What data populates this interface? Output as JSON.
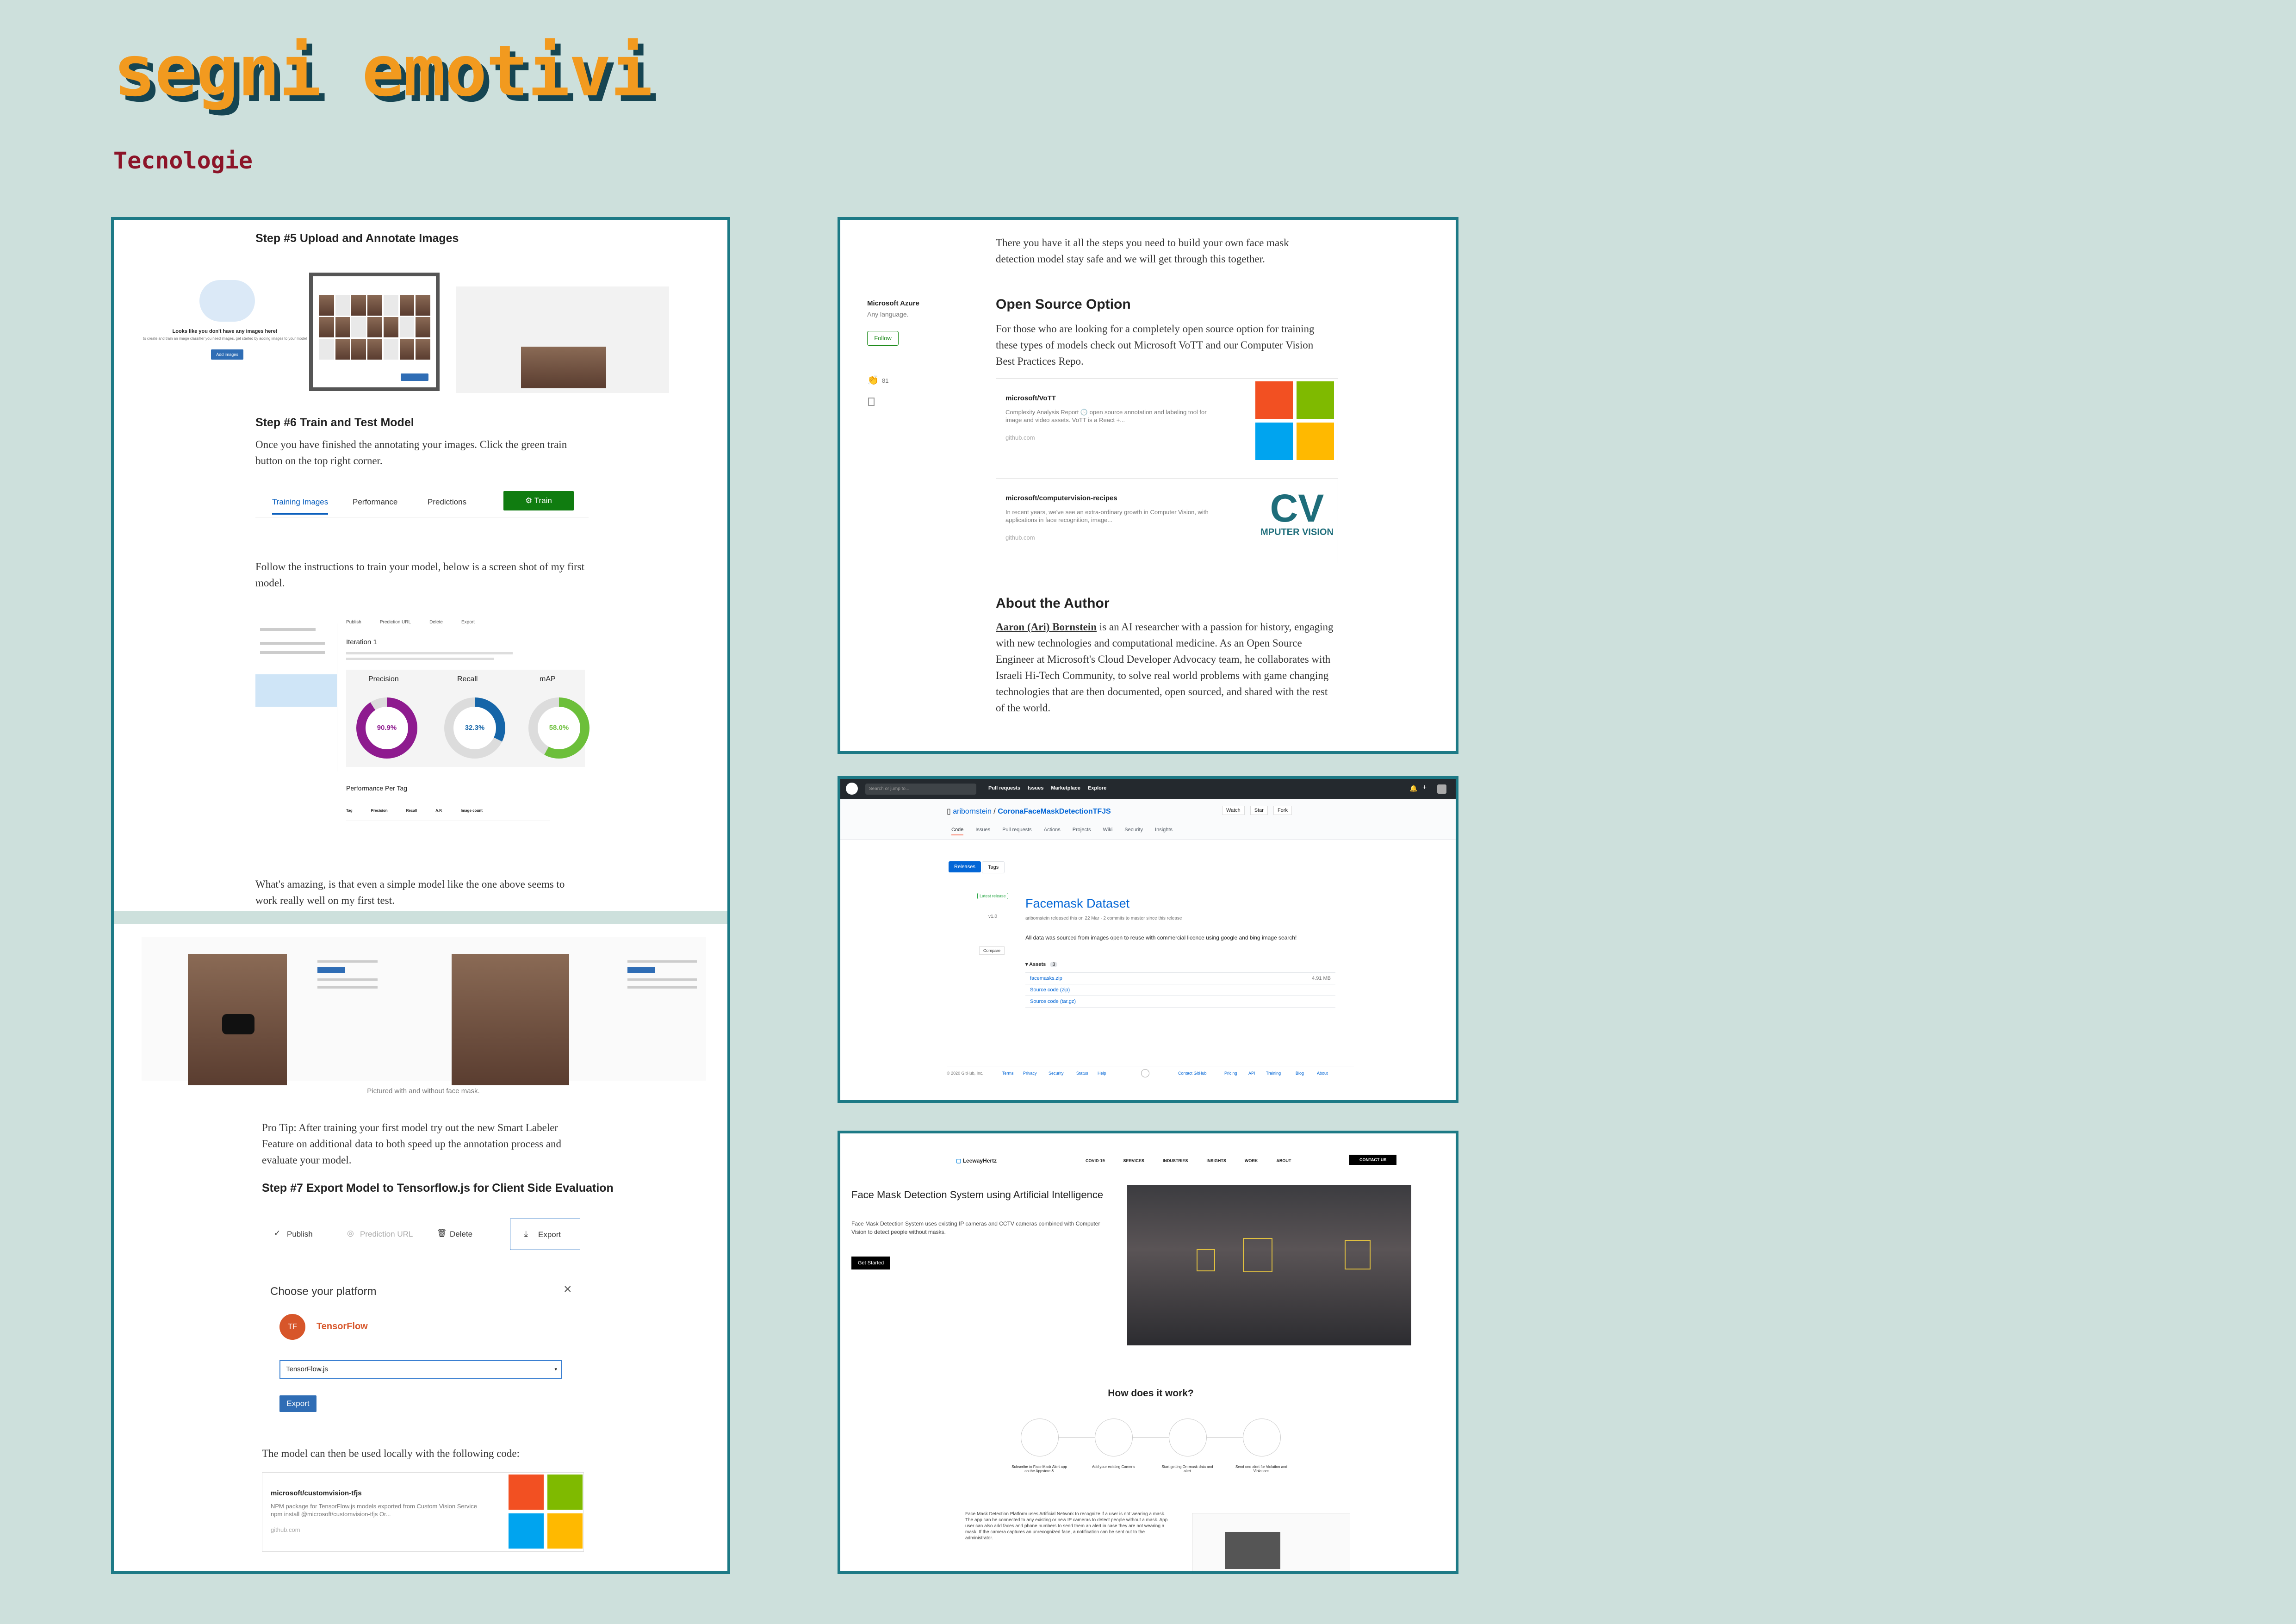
{
  "header": {
    "title": "segni emotivi",
    "subtitle": "Tecnologie"
  },
  "panel1": {
    "step5_title": "Step #5 Upload and Annotate Images",
    "upload_empty_title": "Looks like you don't have any images here!",
    "upload_empty_desc": "to create and train an image classifier you need images, get started by adding images to your model",
    "add_images_label": "Add images",
    "step6_title": "Step #6 Train and Test Model",
    "step6_text": "Once you have finished the annotating your images. Click the green train button on the top right corner.",
    "tabs": [
      "Training Images",
      "Performance",
      "Predictions"
    ],
    "train_label": "Train",
    "follow_text": "Follow the instructions to train your model, below is a screen shot of my first model.",
    "iteration_label": "Iteration 1",
    "toolbar": [
      "Publish",
      "Prediction URL",
      "Delete",
      "Export"
    ],
    "metrics": [
      {
        "name": "Precision",
        "value": "90.9%",
        "pct": 90.9,
        "color": "#8e1b8f"
      },
      {
        "name": "Recall",
        "value": "32.3%",
        "pct": 32.3,
        "color": "#1565a8"
      },
      {
        "name": "mAP",
        "value": "58.0%",
        "pct": 58.0,
        "color": "#6cbf3a"
      }
    ],
    "perf_per_tag": "Performance Per Tag",
    "perf_cols": [
      "Tag",
      "Precision",
      "Recall",
      "A.P.",
      "Image count"
    ],
    "amazing_text": "What's amazing, is that even a simple model like the one above seems to work really well on my first test.",
    "caption": "Pictured with and without face mask.",
    "protip_text": "Pro Tip: After training your first model try out the new Smart Labeler Feature on additional data to both speed up the annotation process and evaluate your model.",
    "step7_title": "Step #7 Export Model to Tensorflow.js for Client Side Evaluation",
    "export_toolbar": [
      "Publish",
      "Prediction URL",
      "Delete",
      "Export"
    ],
    "choose_platform": "Choose your platform",
    "tf_badge": "TF",
    "tf_name": "TensorFlow",
    "select_value": "TensorFlow.js",
    "export_button": "Export",
    "model_text": "The model can then be used locally with the following code:",
    "card_title": "microsoft/customvision-tfjs",
    "card_desc": "NPM package for TensorFlow.js models exported from Custom Vision Service npm install @microsoft/customvision-tfjs Or...",
    "card_source": "github.com"
  },
  "panel2": {
    "intro_text": "There you have it all the steps you need to build your own face mask detection model stay safe and we will get through this together.",
    "author_org": "Microsoft Azure",
    "author_sub": "Any language.",
    "follow_label": "Follow",
    "claps": "81",
    "open_source_title": "Open Source Option",
    "open_source_text": "For those who are looking for a completely open source option for training these types of models check out Microsoft VoTT and our Computer Vision Best Practices Repo.",
    "card1_title": "microsoft/VoTT",
    "card1_desc": "Complexity Analysis Report 🕒 open source annotation and labeling tool for image and video assets. VoTT is a React +...",
    "card1_source": "github.com",
    "card2_title": "microsoft/computervision-recipes",
    "card2_desc": "In recent years, we've see an extra-ordinary growth in Computer Vision, with applications in face recognition, image...",
    "card2_source": "github.com",
    "cv_logo": "CV",
    "cv_text": "MPUTER VISION",
    "about_title": "About the Author",
    "about_name": "Aaron (Ari) Bornstein",
    "about_text": " is an AI researcher with a passion for history, engaging with new technologies and computational medicine. As an Open Source Engineer at Microsoft's Cloud Developer Advocacy team, he collaborates with Israeli Hi-Tech Community, to solve real world problems with game changing technologies that are then documented, open sourced, and shared with the rest of the world."
  },
  "panel3": {
    "search_placeholder": "Search or jump to...",
    "nav": [
      "Pull requests",
      "Issues",
      "Marketplace",
      "Explore"
    ],
    "repo_owner": "aribornstein",
    "repo_name": "CoronaFaceMaskDetectionTFJS",
    "actions": [
      "Watch",
      "Star",
      "Fork"
    ],
    "tabs": [
      "Code",
      "Issues",
      "Pull requests",
      "Actions",
      "Projects",
      "Wiki",
      "Security",
      "Insights"
    ],
    "subtabs": [
      "Releases",
      "Tags"
    ],
    "latest_release": "Latest release",
    "tag": "v1.0",
    "compare": "Compare",
    "release_title": "Facemask Dataset",
    "release_meta": "aribornstein released this on 22 Mar · 2 commits to master since this release",
    "release_desc": "All data was sourced from images open to reuse with commercial licence using google and bing image search!",
    "assets_label": "Assets",
    "assets_count": "3",
    "assets": [
      {
        "name": "facemasks.zip",
        "size": "4.91 MB"
      },
      {
        "name": "Source code (zip)",
        "size": ""
      },
      {
        "name": "Source code (tar.gz)",
        "size": ""
      }
    ],
    "footer_left": [
      "© 2020 GitHub, Inc.",
      "Terms",
      "Privacy",
      "Security",
      "Status",
      "Help"
    ],
    "footer_right": [
      "Contact GitHub",
      "Pricing",
      "API",
      "Training",
      "Blog",
      "About"
    ]
  },
  "panel4": {
    "logo_text": "LeewayHertz",
    "nav": [
      "COVID-19",
      "SERVICES",
      "INDUSTRIES",
      "INSIGHTS",
      "WORK",
      "ABOUT"
    ],
    "contact": "CONTACT US",
    "hero_title": "Face Mask Detection System using Artificial Intelligence",
    "hero_desc": "Face Mask Detection System uses existing IP cameras and CCTV cameras combined with Computer Vision to detect people without masks.",
    "cta": "Get Started",
    "how_title": "How does it work?",
    "steps": [
      "Subscribe to Face Mask Alert app on the Appstore &",
      "Add your existing Camera",
      "Start getting On-mask data and alert",
      "Send one alert for Violation and Violations"
    ],
    "bottom_text": "Face Mask Detection Platform uses Artificial Network to recognize if a user is not wearing a mask. The app can be connected to any existing or new IP cameras to detect people without a mask. App user can also add faces and phone numbers to send them an alert in case they are not wearing a mask. If the camera captures an unrecognized face, a notification can be sent out to the administrator."
  }
}
